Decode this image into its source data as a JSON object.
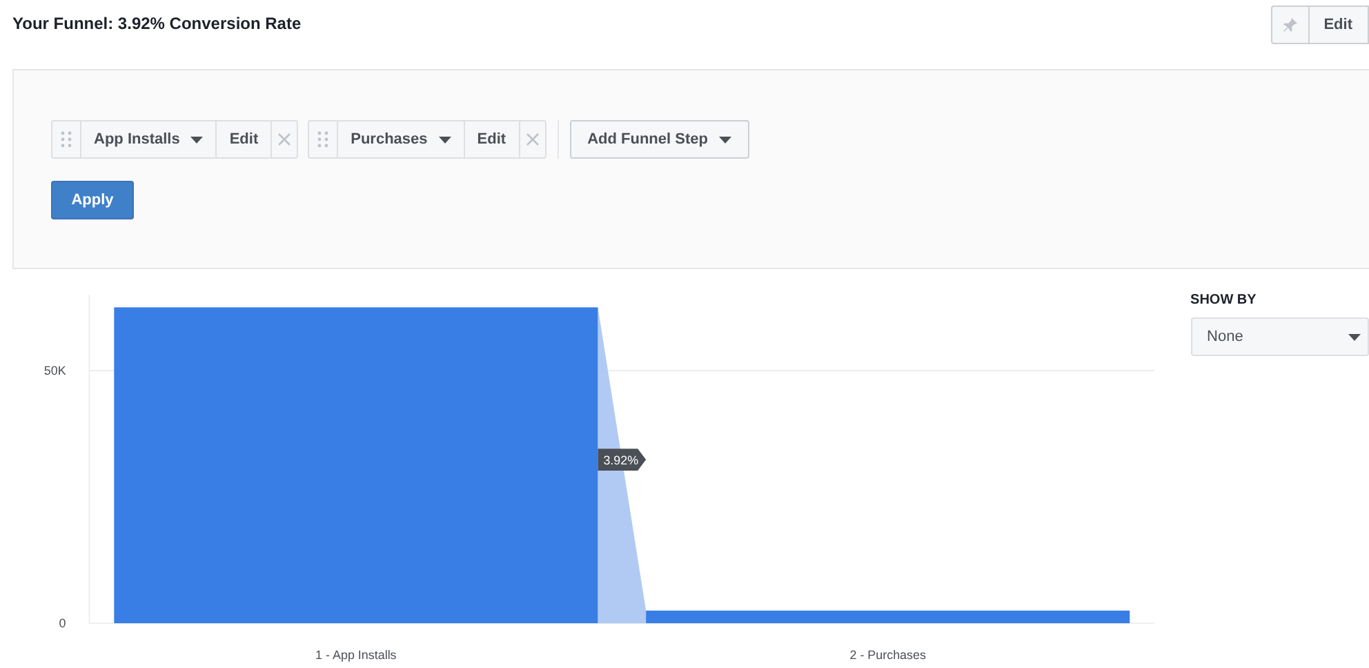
{
  "header": {
    "title": "Your Funnel: 3.92% Conversion Rate",
    "edit_button": "Edit"
  },
  "funnel_steps": [
    {
      "label": "App Installs",
      "edit": "Edit"
    },
    {
      "label": "Purchases",
      "edit": "Edit"
    }
  ],
  "add_step_button": "Add Funnel Step",
  "apply_button": "Apply",
  "chart": {
    "chart_data": {
      "type": "bar",
      "categories": [
        "1 - App Installs",
        "2 - Purchases"
      ],
      "series": [
        {
          "color": "#387ee4",
          "values": [
            62500,
            2500
          ]
        }
      ],
      "ylim": [
        0,
        65000
      ],
      "yticks": [
        0,
        {
          "value": 50000,
          "label": "50K"
        }
      ]
    },
    "conversion_label": "3.92%"
  },
  "show_by": {
    "label": "SHOW BY",
    "value": "None"
  }
}
